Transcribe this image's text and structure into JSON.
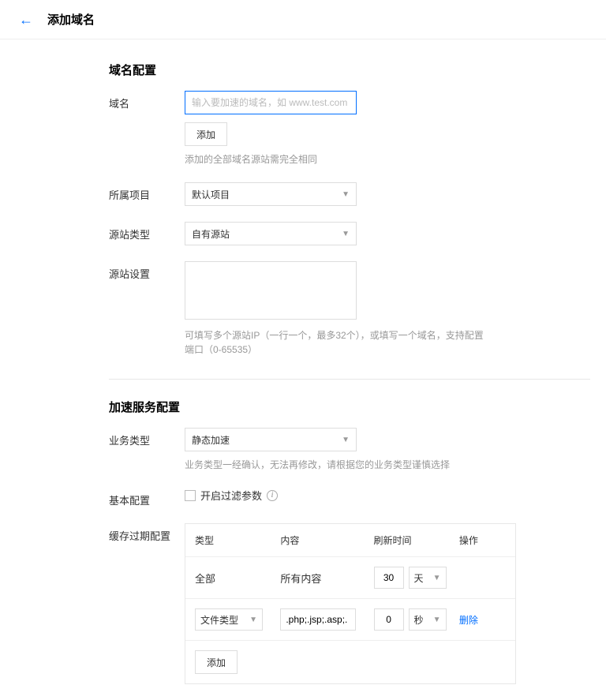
{
  "header": {
    "title": "添加域名"
  },
  "section_domain": {
    "title": "域名配置",
    "domain": {
      "label": "域名",
      "placeholder": "输入要加速的域名，如 www.test.com",
      "add_btn": "添加",
      "helper": "添加的全部域名源站需完全相同"
    },
    "project": {
      "label": "所属项目",
      "value": "默认项目"
    },
    "origin_type": {
      "label": "源站类型",
      "value": "自有源站"
    },
    "origin_settings": {
      "label": "源站设置",
      "helper": "可填写多个源站IP（一行一个，最多32个），或填写一个域名，支持配置端口（0-65535）"
    }
  },
  "section_accel": {
    "title": "加速服务配置",
    "biz_type": {
      "label": "业务类型",
      "value": "静态加速",
      "helper": "业务类型一经确认，无法再修改，请根据您的业务类型谨慎选择"
    },
    "basic": {
      "label": "基本配置",
      "checkbox_label": "开启过滤参数"
    },
    "cache": {
      "label": "缓存过期配置",
      "headers": {
        "type": "类型",
        "content": "内容",
        "refresh": "刷新时间",
        "action": "操作"
      },
      "rows": [
        {
          "type_text": "全部",
          "content_text": "所有内容",
          "refresh_value": "30",
          "refresh_unit": "天",
          "action": ""
        },
        {
          "type_select": "文件类型",
          "content_value": ".php;.jsp;.asp;.",
          "refresh_value": "0",
          "refresh_unit": "秒",
          "action": "删除"
        }
      ],
      "add_btn": "添加"
    }
  }
}
